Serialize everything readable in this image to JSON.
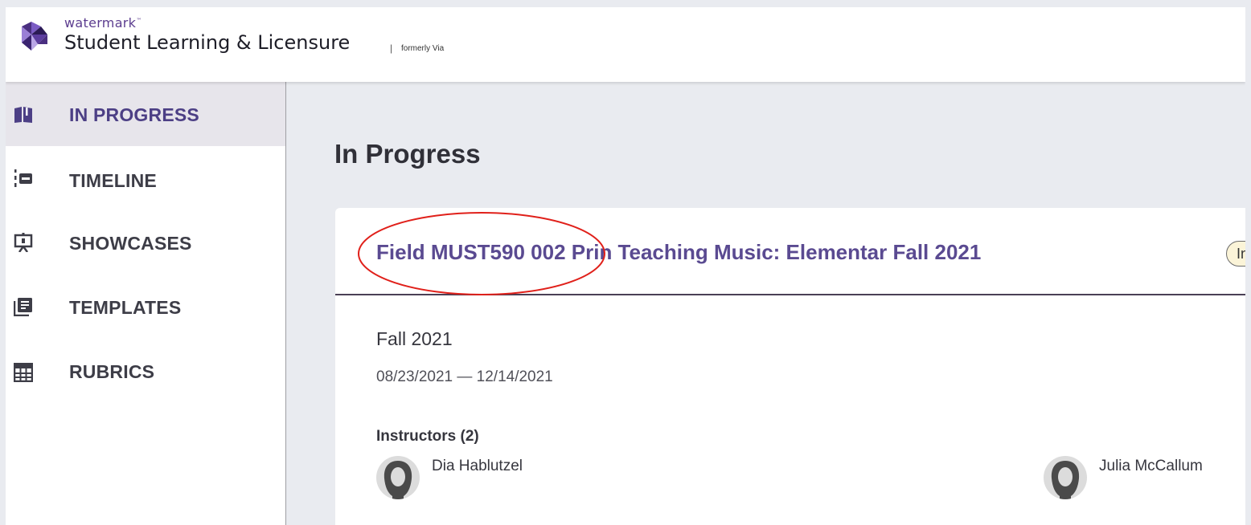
{
  "header": {
    "brand_small": "watermark",
    "brand_tm": "™",
    "brand_main": "Student Learning & Licensure",
    "separator": "|",
    "formerly": "formerly Via"
  },
  "sidebar": {
    "items": [
      {
        "label": "IN PROGRESS",
        "icon": "open-book-icon",
        "active": true
      },
      {
        "label": "TIMELINE",
        "icon": "timeline-icon",
        "active": false
      },
      {
        "label": "SHOWCASES",
        "icon": "presentation-board-icon",
        "active": false
      },
      {
        "label": "TEMPLATES",
        "icon": "document-stack-icon",
        "active": false
      },
      {
        "label": "RUBRICS",
        "icon": "grid-table-icon",
        "active": false
      }
    ]
  },
  "main": {
    "title": "In Progress",
    "card": {
      "title": "Field MUST590 002 Prin Teaching Music: Elementar Fall 2021",
      "badge": "Internship",
      "term": "Fall 2021",
      "dates": "08/23/2021 — 12/14/2021",
      "instructors_label": "Instructors (2)",
      "instructors": [
        {
          "name": "Dia Hablutzel"
        },
        {
          "name": "Julia McCallum"
        }
      ]
    }
  },
  "colors": {
    "accent": "#5a4a91",
    "active_nav_bg": "#e7e5eb",
    "page_bg": "#e9ebf0",
    "badge_bg": "#fbf4d8",
    "annotation": "#e0201a"
  }
}
